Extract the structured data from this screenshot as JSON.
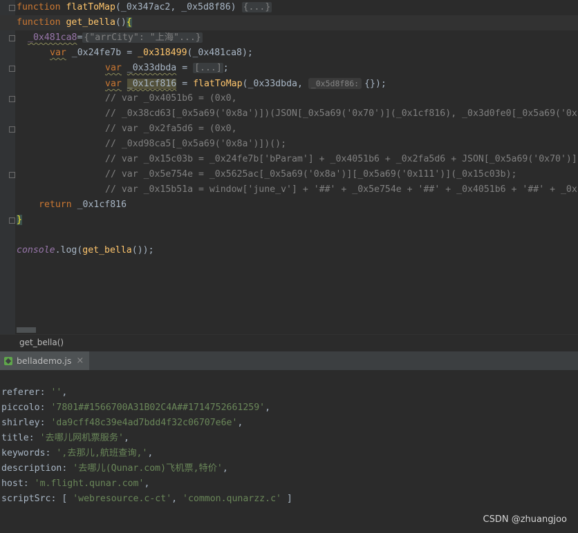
{
  "editor": {
    "line1": {
      "kw": "function",
      "name": "flatToMap",
      "params": "(_0x347ac2, _0x5d8f86)",
      "folded": "{...}"
    },
    "line2": {
      "kw": "function",
      "name": "get_bella",
      "parens": "()",
      "brace": "{"
    },
    "line3": {
      "var": "_0x481ca8",
      "eq": "=",
      "value": "{\"arrCity\": \"上海\"...}"
    },
    "line4": {
      "kw": "var",
      "name": "_0x24fe7b",
      "eq": " = ",
      "call": "_0x318499",
      "args": "(_0x481ca8);"
    },
    "line5": {
      "kw": "var",
      "name": "_0x33dbda",
      "eq": " = ",
      "folded": "[...]",
      "end": ";"
    },
    "line6": {
      "kw": "var",
      "name": "_0x1cf816",
      "eq": " = ",
      "call": "flatToMap",
      "arg1": "(_0x33dbda, ",
      "hint": "_0x5d8f86:",
      "arg2": "{});"
    },
    "comments": [
      "// var _0x4051b6 = (0x0,",
      "// _0x38cd63[_0x5a69('0x8a')])(JSON[_0x5a69('0x70')](_0x1cf816), _0x3d0fe0[_0x5a69('0x",
      "// var _0x2fa5d6 = (0x0,",
      "// _0xd98ca5[_0x5a69('0x8a')])();",
      "// var _0x15c03b = _0x24fe7b['bParam'] + _0x4051b6 + _0x2fa5d6 + JSON[_0x5a69('0x70')]",
      "// var _0x5e754e = _0x5625ac[_0x5a69('0x8a')][_0x5a69('0x111')](_0x15c03b);",
      "// var _0x15b51a = window['june_v'] + '##' + _0x5e754e + '##' + _0x4051b6 + '##' + _0x"
    ],
    "return_line": {
      "kw": "return",
      "value": " _0x1cf816"
    },
    "close_brace": "}",
    "console_line": {
      "obj": "console",
      "rest": ".log(",
      "call": "get_bella",
      "end": "());"
    }
  },
  "breadcrumb": "get_bella()",
  "run_tab": {
    "label": "bellademo.js",
    "close": "×"
  },
  "console_output": [
    {
      "key": "referer: ",
      "val": "''",
      "end": ","
    },
    {
      "key": "piccolo: ",
      "val": "'7801##1566700A31B02C4A##1714752661259'",
      "end": ","
    },
    {
      "key": "shirley: ",
      "val": "'da9cff48c39e4ad7bdd4f32c06707e6e'",
      "end": ","
    },
    {
      "key": "title: ",
      "val": "'去哪儿网机票服务'",
      "end": ","
    },
    {
      "key": "keywords: ",
      "val": "',去那儿,航班查询,'",
      "end": ","
    },
    {
      "key": "description: ",
      "val": "'去哪儿(Qunar.com)飞机票,特价'",
      "end": ","
    },
    {
      "key": "host: ",
      "val": "'m.flight.qunar.com'",
      "end": ","
    },
    {
      "key": "scriptSrc: [ ",
      "val": "'webresource.c-ct'",
      "mid": ", ",
      "val2": "'common.qunarzz.c'",
      "end": " ]"
    }
  ],
  "watermark": "CSDN @zhuangjoo"
}
